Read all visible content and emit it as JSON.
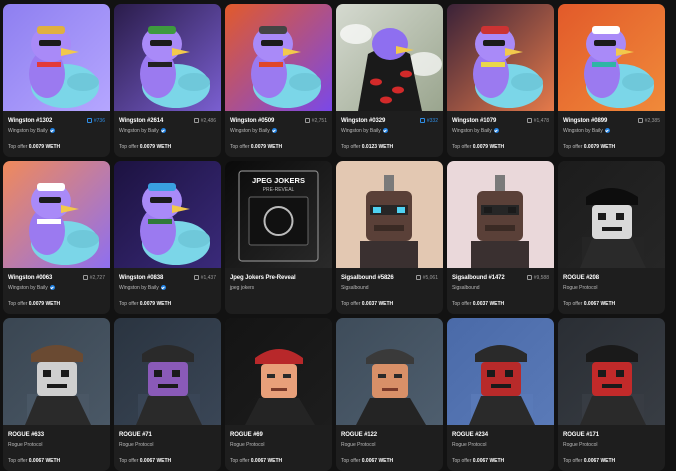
{
  "cards": [
    {
      "name": "Wingston #1302",
      "rank": "#736",
      "rank_gold": true,
      "collection": "Wingston by Baily",
      "verified": true,
      "offer_label": "Top offer",
      "offer_value": "0.0079 WETH",
      "art": {
        "kind": "bird",
        "bg1": "#8e7ff0",
        "bg2": "#b5a6ff",
        "hat": "#e0b040",
        "accent": "#e23a3a"
      }
    },
    {
      "name": "Wingston #2614",
      "rank": "#2,486",
      "rank_gold": false,
      "collection": "Wingston by Baily",
      "verified": true,
      "offer_label": "Top offer",
      "offer_value": "0.0079 WETH",
      "art": {
        "kind": "bird",
        "bg1": "#2a1c4a",
        "bg2": "#7a5fd0",
        "hat": "#3e9a3e",
        "accent": "#222222"
      }
    },
    {
      "name": "Wingston #0509",
      "rank": "#2,751",
      "rank_gold": false,
      "collection": "Wingston by Baily",
      "verified": true,
      "offer_label": "Top offer",
      "offer_value": "0.0079 WETH",
      "art": {
        "kind": "bird",
        "bg1": "#e25a2a",
        "bg2": "#7a48e8",
        "hat": "#444444",
        "accent": "#e0462a"
      }
    },
    {
      "name": "Wingston #0329",
      "rank": "#332",
      "rank_gold": true,
      "collection": "Wingston by Baily",
      "verified": true,
      "offer_label": "Top offer",
      "offer_value": "0.0123 WETH",
      "art": {
        "kind": "cloak",
        "bg1": "#d5dad0",
        "bg2": "#9aa58e",
        "hat": "#1a1a1a",
        "accent": "#d22a2a"
      }
    },
    {
      "name": "Wingston #1079",
      "rank": "#1,478",
      "rank_gold": false,
      "collection": "Wingston by Baily",
      "verified": true,
      "offer_label": "Top offer",
      "offer_value": "0.0079 WETH",
      "art": {
        "kind": "bird",
        "bg1": "#3a2238",
        "bg2": "#e57a4a",
        "hat": "#c33",
        "accent": "#e9d84a"
      }
    },
    {
      "name": "Wingston #0899",
      "rank": "#2,385",
      "rank_gold": false,
      "collection": "Wingston by Baily",
      "verified": true,
      "offer_label": "Top offer",
      "offer_value": "0.0079 WETH",
      "art": {
        "kind": "bird",
        "bg1": "#e25a2a",
        "bg2": "#f08a3a",
        "hat": "#ffffff",
        "accent": "#2fb5a5"
      }
    },
    {
      "name": "Wingston #0063",
      "rank": "#2,727",
      "rank_gold": false,
      "collection": "Wingston by Baily",
      "verified": true,
      "offer_label": "Top offer",
      "offer_value": "0.0079 WETH",
      "art": {
        "kind": "bird",
        "bg1": "#f08a5a",
        "bg2": "#8e6ff0",
        "hat": "#ffffff",
        "accent": "#ffffff"
      }
    },
    {
      "name": "Wingston #0838",
      "rank": "#1,437",
      "rank_gold": false,
      "collection": "Wingston by Baily",
      "verified": true,
      "offer_label": "Top offer",
      "offer_value": "0.0079 WETH",
      "art": {
        "kind": "bird",
        "bg1": "#1c1240",
        "bg2": "#3a2a7a",
        "hat": "#39a0e0",
        "accent": "#2f7a3a"
      }
    },
    {
      "name": "Jpeg Jokers Pre-Reveal",
      "rank": "",
      "rank_gold": false,
      "collection": "jpeg jokers",
      "verified": false,
      "offer_label": "",
      "offer_value": "",
      "art": {
        "kind": "card",
        "bg1": "#0a0a0a",
        "bg2": "#2a2a2a",
        "hat": "#ffffff",
        "accent": "#bbbbbb",
        "title": "JPEG JOKERS",
        "sub": "PRE-REVEAL"
      }
    },
    {
      "name": "Sigsalbound #5826",
      "rank": "#5,061",
      "rank_gold": false,
      "collection": "Sigsalbound",
      "verified": false,
      "offer_label": "Top offer",
      "offer_value": "0.0037 WETH",
      "art": {
        "kind": "robot",
        "bg1": "#e3c8b2",
        "bg2": "#e3c8b2",
        "hat": "#3a3030",
        "accent": "#4fd2f2"
      }
    },
    {
      "name": "Sigsalbound #1472",
      "rank": "#9,588",
      "rank_gold": false,
      "collection": "Sigsalbound",
      "verified": false,
      "offer_label": "Top offer",
      "offer_value": "0.0037 WETH",
      "art": {
        "kind": "robot",
        "bg1": "#ead8da",
        "bg2": "#ead8da",
        "hat": "#3a3030",
        "accent": "#1a1a1a"
      }
    },
    {
      "name": "ROGUE #208",
      "rank": "",
      "rank_gold": false,
      "collection": "Rogue Protocol",
      "verified": false,
      "offer_label": "Top offer",
      "offer_value": "0.0067 WETH",
      "art": {
        "kind": "rogue",
        "bg1": "#1c1c1c",
        "bg2": "#262626",
        "hat": "#0d0d0d",
        "accent": "#d9d9d9"
      }
    },
    {
      "name": "ROGUE #633",
      "rank": "",
      "rank_gold": false,
      "collection": "Rogue Protocol",
      "verified": false,
      "offer_label": "Top offer",
      "offer_value": "0.0067 WETH",
      "art": {
        "kind": "rogue",
        "bg1": "#3a4652",
        "bg2": "#4a5866",
        "hat": "#6a4a32",
        "accent": "#cfcfcf"
      }
    },
    {
      "name": "ROGUE #71",
      "rank": "",
      "rank_gold": false,
      "collection": "Rogue Protocol",
      "verified": false,
      "offer_label": "Top offer",
      "offer_value": "0.0067 WETH",
      "art": {
        "kind": "rogue",
        "bg1": "#2a3440",
        "bg2": "#3a4656",
        "hat": "#2a2a2a",
        "accent": "#8a5ab8"
      }
    },
    {
      "name": "ROGUE #69",
      "rank": "",
      "rank_gold": false,
      "collection": "Rogue Protocol",
      "verified": false,
      "offer_label": "Top offer",
      "offer_value": "0.0067 WETH",
      "art": {
        "kind": "human",
        "bg1": "#141414",
        "bg2": "#1d1d1d",
        "hat": "#b8282a",
        "accent": "#e8a07a"
      }
    },
    {
      "name": "ROGUE #122",
      "rank": "",
      "rank_gold": false,
      "collection": "Rogue Protocol",
      "verified": false,
      "offer_label": "Top offer",
      "offer_value": "0.0067 WETH",
      "art": {
        "kind": "human",
        "bg1": "#3e4c5a",
        "bg2": "#4e5e6e",
        "hat": "#3a3a3a",
        "accent": "#d89068"
      }
    },
    {
      "name": "ROGUE #234",
      "rank": "",
      "rank_gold": false,
      "collection": "Rogue Protocol",
      "verified": false,
      "offer_label": "Top offer",
      "offer_value": "0.0067 WETH",
      "art": {
        "kind": "rogue",
        "bg1": "#4a6aa8",
        "bg2": "#5a7ab8",
        "hat": "#2a2a2a",
        "accent": "#b82a2a"
      }
    },
    {
      "name": "ROGUE #171",
      "rank": "",
      "rank_gold": false,
      "collection": "Rogue Protocol",
      "verified": false,
      "offer_label": "Top offer",
      "offer_value": "0.0067 WETH",
      "art": {
        "kind": "rogue",
        "bg1": "#2a2e34",
        "bg2": "#383d44",
        "hat": "#1a1a1a",
        "accent": "#c22a2a"
      }
    }
  ]
}
